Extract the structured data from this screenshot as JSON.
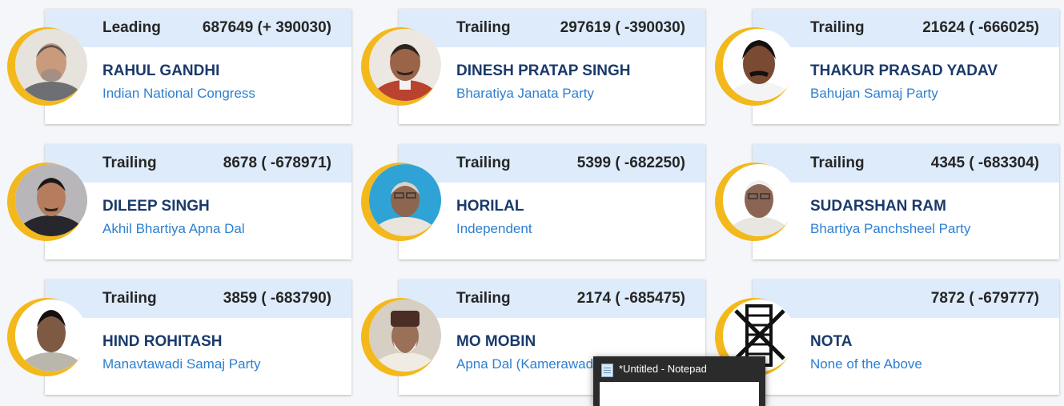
{
  "candidates": [
    {
      "status": "Leading",
      "votes": "687649 (+ 390030)",
      "name": "RAHUL GANDHI",
      "party": "Indian National Congress"
    },
    {
      "status": "Trailing",
      "votes": "297619 ( -390030)",
      "name": "DINESH PRATAP SINGH",
      "party": "Bharatiya Janata Party"
    },
    {
      "status": "Trailing",
      "votes": "21624 ( -666025)",
      "name": "THAKUR PRASAD YADAV",
      "party": "Bahujan Samaj Party"
    },
    {
      "status": "Trailing",
      "votes": "8678 ( -678971)",
      "name": "DILEEP SINGH",
      "party": "Akhil Bhartiya Apna Dal"
    },
    {
      "status": "Trailing",
      "votes": "5399 ( -682250)",
      "name": "HORILAL",
      "party": "Independent"
    },
    {
      "status": "Trailing",
      "votes": "4345 ( -683304)",
      "name": "SUDARSHAN RAM",
      "party": "Bhartiya Panchsheel Party"
    },
    {
      "status": "Trailing",
      "votes": "3859 ( -683790)",
      "name": "HIND ROHITASH",
      "party": "Manavtawadi Samaj Party"
    },
    {
      "status": "Trailing",
      "votes": "2174 ( -685475)",
      "name": "MO MOBIN",
      "party": "Apna Dal (Kamerawadi)"
    },
    {
      "status": "",
      "votes": "7872 ( -679777)",
      "name": "NOTA",
      "party": "None of the Above"
    }
  ],
  "notepad": {
    "title": "*Untitled - Notepad",
    "icon": "notepad-icon"
  },
  "colors": {
    "header": "#deebfb",
    "name": "#1a3a6b",
    "party": "#2d7fd0",
    "ring": "#f3b81b"
  }
}
